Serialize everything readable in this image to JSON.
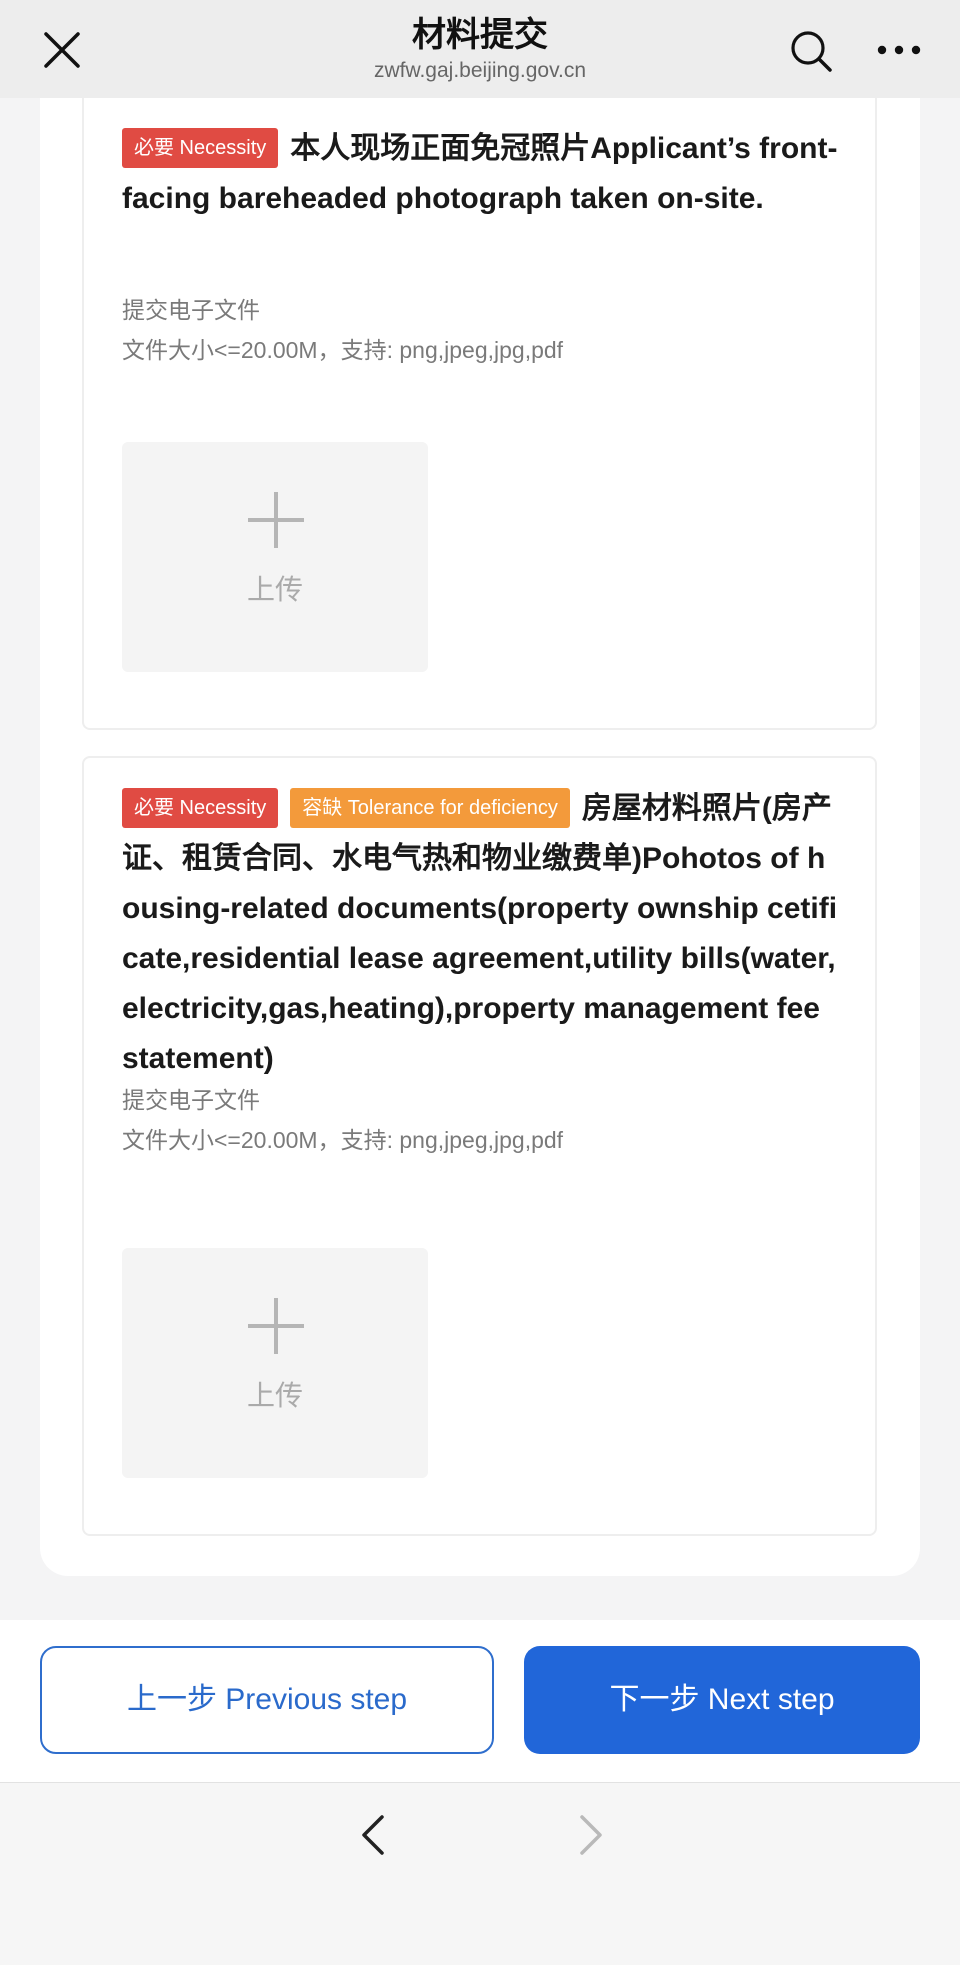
{
  "header": {
    "title": "材料提交",
    "url": "zwfw.gaj.beijing.gov.cn",
    "icons": [
      "close-icon",
      "search-icon",
      "more-icon"
    ]
  },
  "items": [
    {
      "badges": [
        {
          "text": "必要 Necessity",
          "color": "#e04b43"
        }
      ],
      "title": "本人现场正面免冠照片Applicant’s front-facing bareheaded photograph taken on-site.",
      "submit_type": "提交电子文件",
      "file_rule": "文件大小<=20.00M，支持: png,jpeg,jpg,pdf",
      "upload_label": "上传"
    },
    {
      "badges": [
        {
          "text": "必要 Necessity",
          "color": "#e04b43"
        },
        {
          "text": "容缺 Tolerance for deficiency",
          "color": "#f39a3b"
        }
      ],
      "title": "房屋材料照片(房产证、租赁合同、水电气热和物业缴费单)Pohotos of housing-related documents(property ownship cetificate,residential lease agreement,utility bills(water,electricity,gas,heating),property management fee statement)",
      "submit_type": "提交电子文件",
      "file_rule": "文件大小<=20.00M，支持: png,jpeg,jpg,pdf",
      "upload_label": "上传"
    }
  ],
  "footer": {
    "prev_label": "上一步 Previous step",
    "next_label": "下一步 Next step"
  },
  "browser_nav": {
    "icons": [
      "back-arrow-icon",
      "forward-arrow-icon"
    ]
  },
  "colors": {
    "primary": "#2166d9",
    "necessity": "#e04b43",
    "tolerance": "#f39a3b"
  }
}
